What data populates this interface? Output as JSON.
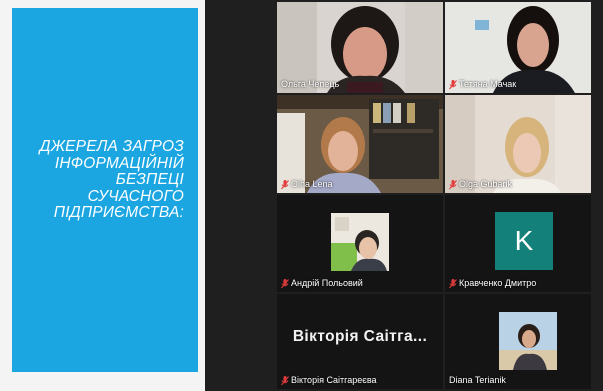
{
  "slide": {
    "title": "ДЖЕРЕЛА ЗАГРОЗ\nІНФОРМАЦІЙНІЙ\nБЕЗПЕЦІ\nСУЧАСНОГО\nПІДПРИЄМСТВА:"
  },
  "participants": [
    {
      "name": "Ольга Чепець",
      "muted": false,
      "active": true
    },
    {
      "name": "Тетяна Мачак",
      "muted": true
    },
    {
      "name": "Olha Lena",
      "muted": true
    },
    {
      "name": "Olga Gubarik",
      "muted": true
    },
    {
      "name": "Андрій Польовий",
      "muted": true
    },
    {
      "name": "Кравченко Дмитро",
      "muted": true,
      "avatar_letter": "K"
    },
    {
      "name": "Вікторія Саітгареєва",
      "muted": true,
      "display_name": "Вікторія Саітга..."
    },
    {
      "name": "Diana Terianik",
      "muted": false
    }
  ],
  "colors": {
    "slide_bg": "#1ba6e2",
    "stage_bg": "#1f1f1f",
    "active_border": "#8be04e",
    "muted_icon": "#e23b3b",
    "avatar_bg": "#13817a"
  }
}
